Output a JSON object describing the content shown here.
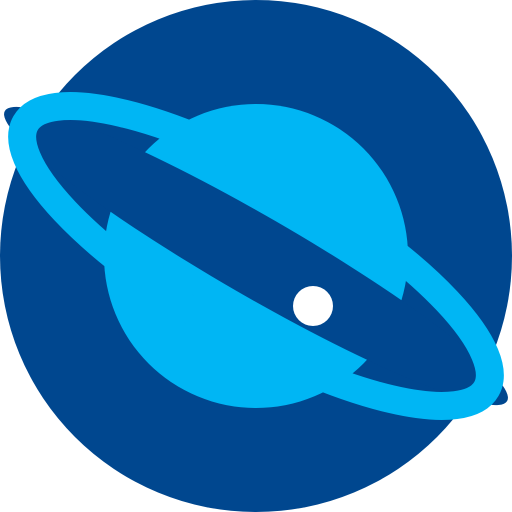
{
  "icon": {
    "name": "planet-icon",
    "colors": {
      "background_circle": "#00478F",
      "planet": "#00B6F4",
      "ring": "#00B6F4",
      "moon": "#FFFFFF"
    }
  }
}
